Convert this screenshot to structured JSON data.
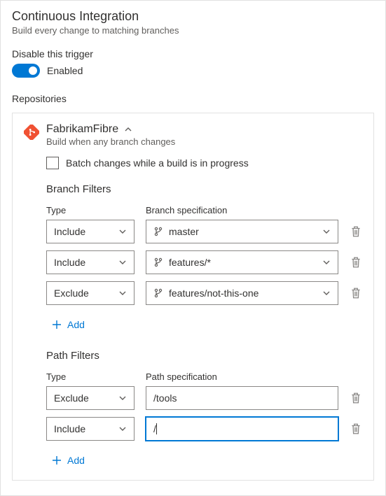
{
  "header": {
    "title": "Continuous Integration",
    "subtitle": "Build every change to matching branches"
  },
  "trigger": {
    "label": "Disable this trigger",
    "state_label": "Enabled"
  },
  "repositories_label": "Repositories",
  "repo": {
    "name": "FabrikamFibre",
    "description": "Build when any branch changes",
    "batch_label": "Batch changes while a build is in progress"
  },
  "branch_filters": {
    "heading": "Branch Filters",
    "type_label": "Type",
    "spec_label": "Branch specification",
    "rows": [
      {
        "type": "Include",
        "spec": "master"
      },
      {
        "type": "Include",
        "spec": "features/*"
      },
      {
        "type": "Exclude",
        "spec": "features/not-this-one"
      }
    ],
    "add_label": "Add"
  },
  "path_filters": {
    "heading": "Path Filters",
    "type_label": "Type",
    "spec_label": "Path specification",
    "rows": [
      {
        "type": "Exclude",
        "spec": "/tools"
      },
      {
        "type": "Include",
        "spec": "/"
      }
    ],
    "add_label": "Add"
  }
}
